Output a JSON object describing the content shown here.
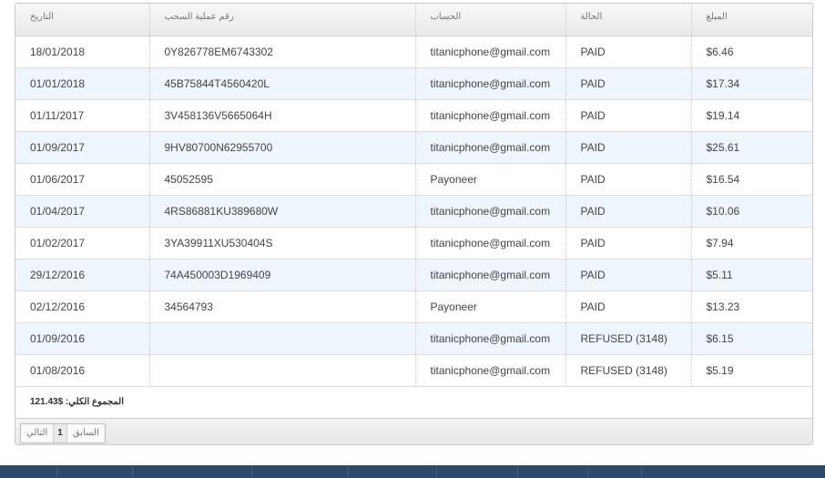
{
  "columns": {
    "date": "التاريخ",
    "withdrawal_id": "رقم عملية السحب",
    "account": "الحساب",
    "status": "الحالة",
    "amount": "المبلغ"
  },
  "rows": [
    {
      "date": "18/01/2018",
      "withdrawal_id": "0Y826778EM6743302",
      "account": "titanicphone@gmail.com",
      "status": "PAID",
      "amount": "$6.46"
    },
    {
      "date": "01/01/2018",
      "withdrawal_id": "45B75844T4560420L",
      "account": "titanicphone@gmail.com",
      "status": "PAID",
      "amount": "$17.34"
    },
    {
      "date": "01/11/2017",
      "withdrawal_id": "3V458136V5665064H",
      "account": "titanicphone@gmail.com",
      "status": "PAID",
      "amount": "$19.14"
    },
    {
      "date": "01/09/2017",
      "withdrawal_id": "9HV80700N62955700",
      "account": "titanicphone@gmail.com",
      "status": "PAID",
      "amount": "$25.61"
    },
    {
      "date": "01/06/2017",
      "withdrawal_id": "45052595",
      "account": "Payoneer",
      "status": "PAID",
      "amount": "$16.54"
    },
    {
      "date": "01/04/2017",
      "withdrawal_id": "4RS86881KU389680W",
      "account": "titanicphone@gmail.com",
      "status": "PAID",
      "amount": "$10.06"
    },
    {
      "date": "01/02/2017",
      "withdrawal_id": "3YA39911XU530404S",
      "account": "titanicphone@gmail.com",
      "status": "PAID",
      "amount": "$7.94"
    },
    {
      "date": "29/12/2016",
      "withdrawal_id": "74A450003D1969409",
      "account": "titanicphone@gmail.com",
      "status": "PAID",
      "amount": "$5.11"
    },
    {
      "date": "02/12/2016",
      "withdrawal_id": "34564793",
      "account": "Payoneer",
      "status": "PAID",
      "amount": "$13.23"
    },
    {
      "date": "01/09/2016",
      "withdrawal_id": "",
      "account": "titanicphone@gmail.com",
      "status": "REFUSED (3148)",
      "amount": "$6.15"
    },
    {
      "date": "01/08/2016",
      "withdrawal_id": "",
      "account": "titanicphone@gmail.com",
      "status": "REFUSED (3148)",
      "amount": "$5.19"
    }
  ],
  "total_text": "المجموع الكلي: $121.43",
  "pagination": {
    "prev": "السابق",
    "current": "1",
    "next": "التالي"
  },
  "colors": {
    "row_alt": "#eef5fc",
    "footer_bar": "#2c4a6b"
  }
}
